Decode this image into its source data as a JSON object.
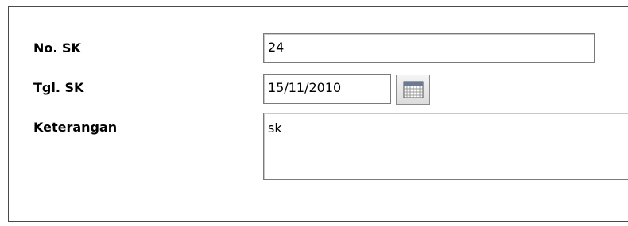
{
  "form": {
    "no_sk": {
      "label": "No. SK",
      "value": "24"
    },
    "tgl_sk": {
      "label": "Tgl. SK",
      "value": "15/11/2010",
      "picker_icon": "calendar-icon"
    },
    "keterangan": {
      "label": "Keterangan",
      "value": "sk"
    }
  }
}
